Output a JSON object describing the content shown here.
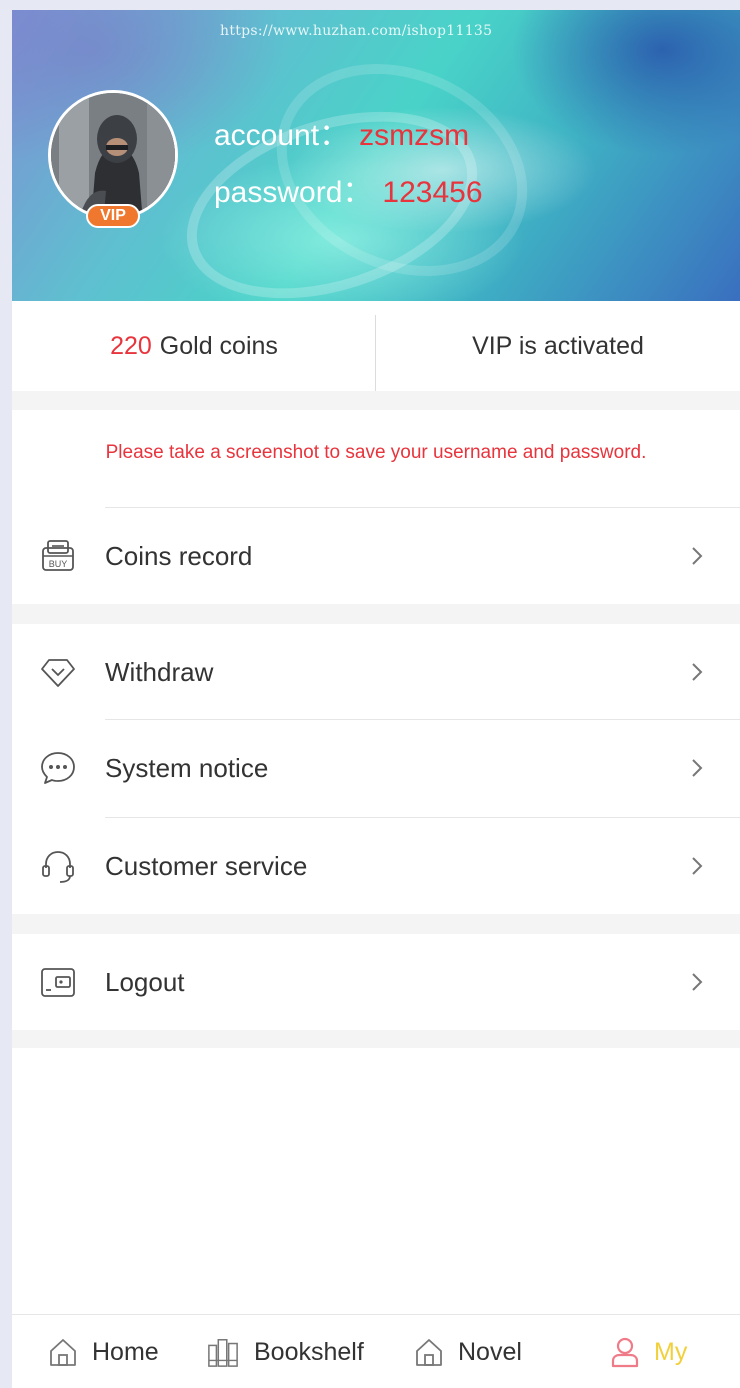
{
  "header": {
    "watermark": "https://www.huzhan.com/ishop11135",
    "vip_badge": "VIP",
    "account_label": "account：",
    "account_value": "zsmzsm",
    "password_label": "password：",
    "password_value": "123456"
  },
  "stats": {
    "coins_value": "220",
    "coins_label": "Gold coins",
    "vip_status": "VIP is activated"
  },
  "notice": "Please take a screenshot to save your username and password.",
  "menu": {
    "coins_record": "Coins record",
    "withdraw": "Withdraw",
    "system_notice": "System notice",
    "customer_service": "Customer service",
    "logout": "Logout"
  },
  "tabs": {
    "home": "Home",
    "bookshelf": "Bookshelf",
    "novel": "Novel",
    "my": "My"
  },
  "colors": {
    "accent_red": "#e8343c",
    "active_tab_text": "#f2d03b",
    "active_tab_icon": "#f07b88",
    "vip_badge": "#f0782e"
  },
  "icons": [
    "buy-icon",
    "diamond-icon",
    "chat-bubble-icon",
    "headset-icon",
    "wallet-icon",
    "chevron-right-icon",
    "home-icon",
    "bookshelf-icon",
    "novel-home-icon",
    "user-icon"
  ]
}
